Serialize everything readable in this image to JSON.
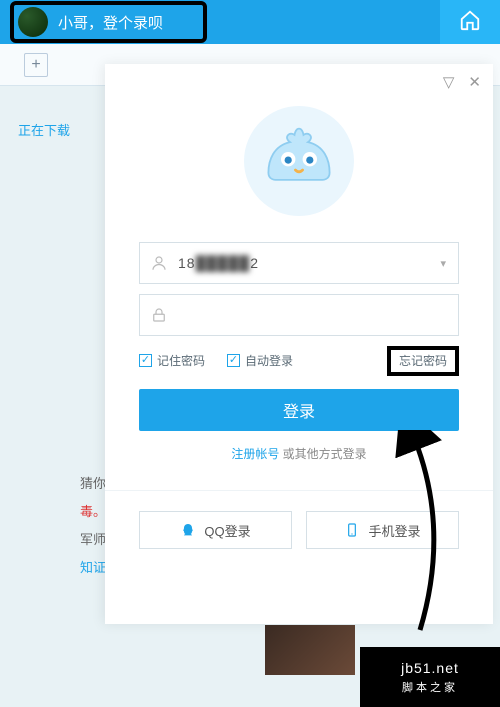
{
  "topbar": {
    "greeting": "小哥，登个录呗"
  },
  "subbar": {
    "newtab": "+"
  },
  "sidebar": {
    "downloading": "正在下载"
  },
  "sidelinks": {
    "l1": "猜你",
    "l2": "毒。",
    "l3": "军师",
    "l4": "知证"
  },
  "panel": {
    "dropdown_glyph": "▽",
    "close_glyph": "✕",
    "account": {
      "prefix": "18",
      "masked": "█████",
      "suffix": "2",
      "caret": "▾"
    },
    "options": {
      "remember": "记住密码",
      "autologin": "自动登录",
      "check": "✓"
    },
    "forgot": "忘记密码",
    "login_btn": "登录",
    "register": "注册帐号",
    "other_login": " 或其他方式登录",
    "qq_login": "QQ登录",
    "phone_login": "手机登录"
  },
  "watermark": {
    "url": "jb51.net",
    "name": "脚本之家"
  }
}
